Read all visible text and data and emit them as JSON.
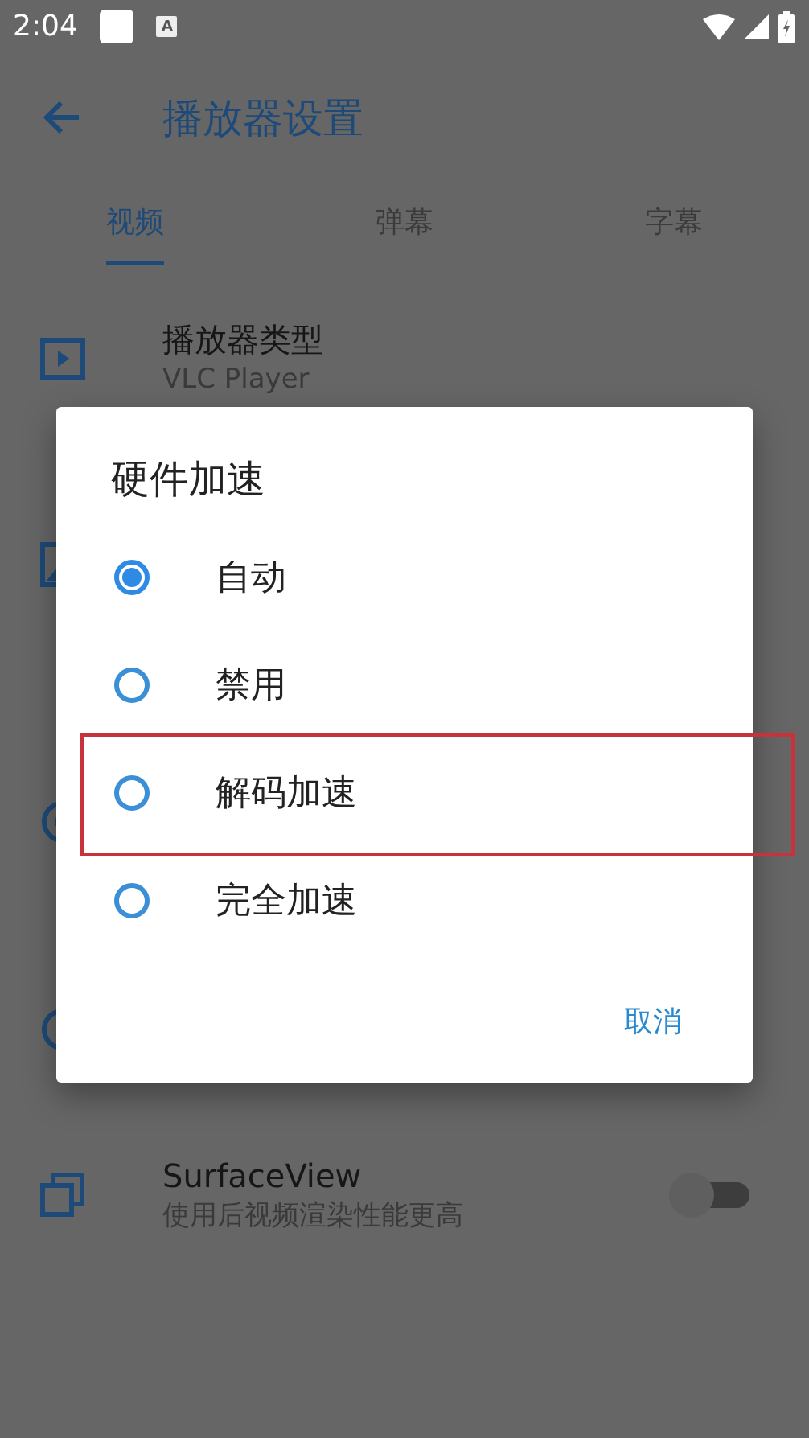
{
  "status_bar": {
    "time": "2:04",
    "notification_glyph": "A"
  },
  "app_bar": {
    "title": "播放器设置"
  },
  "tabs": [
    {
      "label": "视频",
      "selected": true
    },
    {
      "label": "弹幕",
      "selected": false
    },
    {
      "label": "字幕",
      "selected": false
    }
  ],
  "settings": [
    {
      "kind": "info",
      "title": "播放器类型",
      "subtitle": "VLC Player"
    },
    {
      "kind": "covered"
    },
    {
      "kind": "covered"
    },
    {
      "kind": "covered"
    },
    {
      "kind": "switch",
      "title": "SurfaceView",
      "subtitle": "使用后视频渲染性能更高",
      "on": false
    }
  ],
  "dialog": {
    "title": "硬件加速",
    "options": [
      {
        "label": "自动",
        "selected": true,
        "highlighted": false
      },
      {
        "label": "禁用",
        "selected": false,
        "highlighted": false
      },
      {
        "label": "解码加速",
        "selected": false,
        "highlighted": true
      },
      {
        "label": "完全加速",
        "selected": false,
        "highlighted": false
      }
    ],
    "buttons": [
      "取消"
    ]
  }
}
